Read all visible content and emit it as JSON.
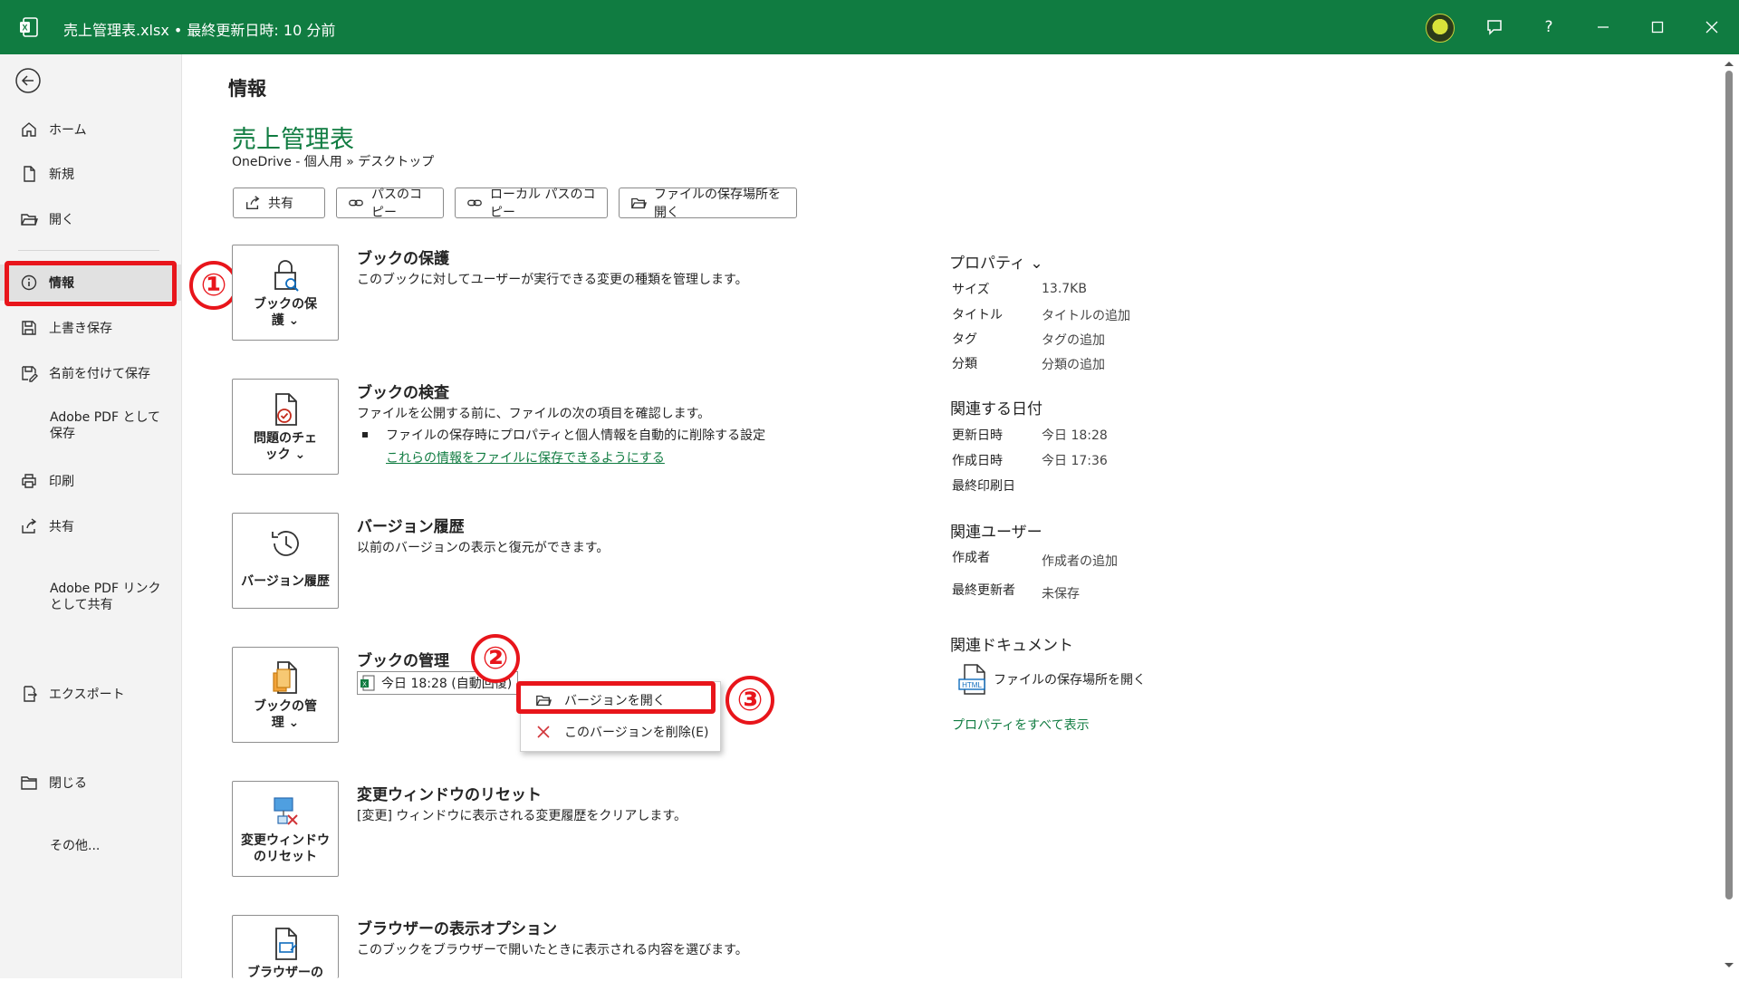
{
  "window": {
    "title": "売上管理表.xlsx • 最終更新日時: 10 分前",
    "help_label": "?"
  },
  "sidebar": {
    "items": [
      {
        "label": "ホーム",
        "icon": "home-icon"
      },
      {
        "label": "新規",
        "icon": "new-file-icon"
      },
      {
        "label": "開く",
        "icon": "folder-open-icon"
      },
      {
        "label": "情報",
        "icon": "info-icon"
      },
      {
        "label": "上書き保存",
        "icon": "save-icon"
      },
      {
        "label": "名前を付けて保存",
        "icon": "save-as-icon"
      },
      {
        "label": "Adobe PDF として保存",
        "icon": ""
      },
      {
        "label": "印刷",
        "icon": "print-icon"
      },
      {
        "label": "共有",
        "icon": "share-icon"
      },
      {
        "label": "Adobe PDF リンクとして共有",
        "icon": ""
      },
      {
        "label": "エクスポート",
        "icon": "export-icon"
      },
      {
        "label": "閉じる",
        "icon": "close-folder-icon"
      },
      {
        "label": "その他...",
        "icon": ""
      }
    ]
  },
  "annotations": {
    "one": "①",
    "two": "②",
    "three": "③"
  },
  "main": {
    "heading": "情報",
    "doc_title": "売上管理表",
    "doc_path": "OneDrive - 個人用 » デスクトップ",
    "actions": [
      {
        "label": "共有"
      },
      {
        "label": "パスのコピー"
      },
      {
        "label": "ローカル パスのコピー"
      },
      {
        "label": "ファイルの保存場所を開く"
      }
    ],
    "sections": {
      "protect": {
        "card_label": "ブックの保護 ⌄",
        "title": "ブックの保護",
        "desc": "このブックに対してユーザーが実行できる変更の種類を管理します。"
      },
      "inspect": {
        "card_label": "問題のチェック ⌄",
        "title": "ブックの検査",
        "desc": "ファイルを公開する前に、ファイルの次の項目を確認します。",
        "bullet": "ファイルの保存時にプロパティと個人情報を自動的に削除する設定",
        "link": "これらの情報をファイルに保存できるようにする"
      },
      "history": {
        "card_label": "バージョン履歴",
        "title": "バージョン履歴",
        "desc": "以前のバージョンの表示と復元ができます。"
      },
      "manage": {
        "card_label": "ブックの管理 ⌄",
        "title": "ブックの管理",
        "version_label": "今日 18:28 (自動回復)"
      },
      "reset": {
        "card_label": "変更ウィンドウのリセット",
        "title": "変更ウィンドウのリセット",
        "desc": "[変更] ウィンドウに表示される変更履歴をクリアします。"
      },
      "browser": {
        "card_label": "ブラウザーの",
        "title": "ブラウザーの表示オプション",
        "desc": "このブックをブラウザーで開いたときに表示される内容を選びます。"
      }
    },
    "context_menu": [
      {
        "label": "バージョンを開く"
      },
      {
        "label": "このバージョンを削除(E)"
      }
    ]
  },
  "properties": {
    "title": "プロパティ ⌄",
    "rows": [
      {
        "label": "サイズ",
        "value": "13.7KB"
      },
      {
        "label": "タイトル",
        "value": "タイトルの追加"
      },
      {
        "label": "タグ",
        "value": "タグの追加"
      },
      {
        "label": "分類",
        "value": "分類の追加"
      }
    ],
    "dates_title": "関連する日付",
    "dates": [
      {
        "label": "更新日時",
        "value": "今日 18:28"
      },
      {
        "label": "作成日時",
        "value": "今日 17:36"
      },
      {
        "label": "最終印刷日",
        "value": ""
      }
    ],
    "users_title": "関連ユーザー",
    "users": [
      {
        "label": "作成者",
        "value": "作成者の追加"
      },
      {
        "label": "最終更新者",
        "value": "未保存"
      }
    ],
    "docs_title": "関連ドキュメント",
    "doc_link": "ファイルの保存場所を開く",
    "show_all": "プロパティをすべて表示"
  },
  "colors": {
    "accent": "#107c41",
    "annotation": "#e8151b"
  }
}
